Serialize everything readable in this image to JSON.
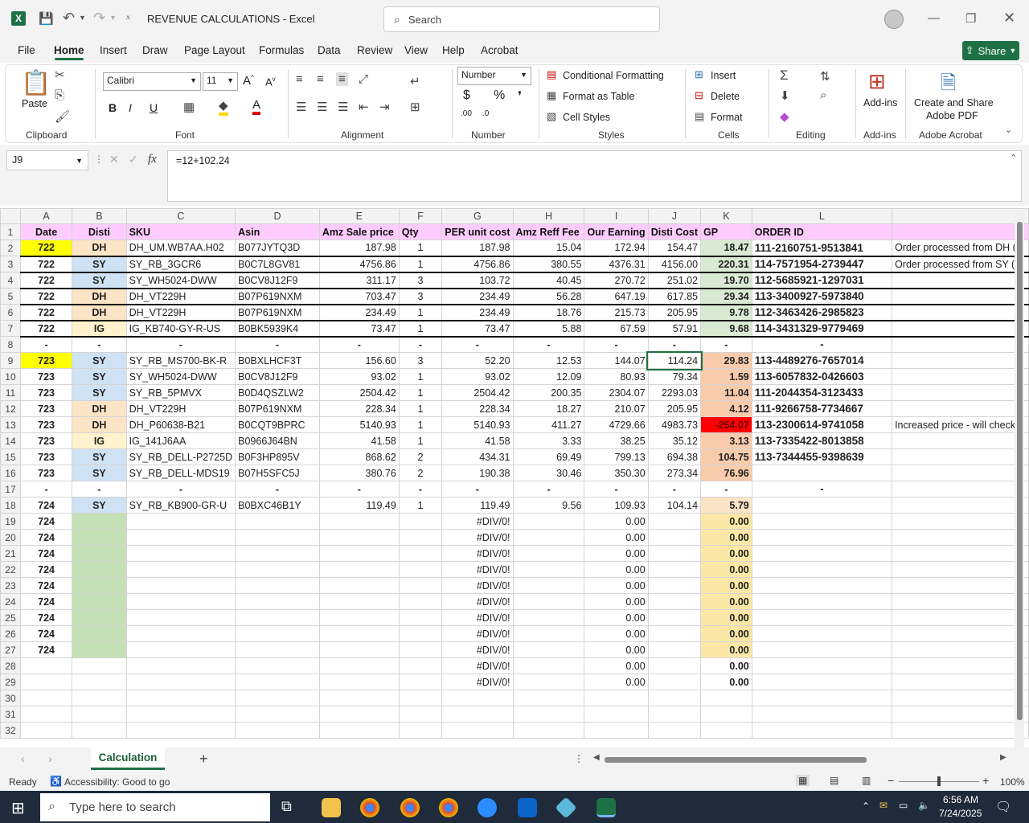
{
  "titlebar": {
    "title": "REVENUE CALCULATIONS  -  Excel",
    "search_placeholder": "Search"
  },
  "menu": {
    "items": [
      "File",
      "Home",
      "Insert",
      "Draw",
      "Page Layout",
      "Formulas",
      "Data",
      "Review",
      "View",
      "Help",
      "Acrobat"
    ],
    "active": "Home",
    "share_label": "Share"
  },
  "ribbon": {
    "clipboard": {
      "paste": "Paste",
      "label": "Clipboard"
    },
    "font": {
      "name": "Calibri",
      "size": "11",
      "label": "Font"
    },
    "alignment": {
      "label": "Alignment"
    },
    "number": {
      "format": "Number",
      "label": "Number"
    },
    "styles": {
      "conditional": "Conditional Formatting",
      "format_table": "Format as Table",
      "cell_styles": "Cell Styles",
      "label": "Styles"
    },
    "cells": {
      "insert": "Insert",
      "delete": "Delete",
      "format": "Format",
      "label": "Cells"
    },
    "editing": {
      "label": "Editing"
    },
    "addins": {
      "btn": "Add-ins",
      "label": "Add-ins"
    },
    "acrobat": {
      "btn1": "Create and Share",
      "btn2": "Adobe PDF",
      "label": "Adobe Acrobat"
    }
  },
  "formula": {
    "namebox": "J9",
    "fx": "fx",
    "value": "=12+102.24"
  },
  "columns": [
    "A",
    "B",
    "C",
    "D",
    "E",
    "F",
    "G",
    "H",
    "I",
    "J",
    "K",
    "L"
  ],
  "headers": [
    "Date",
    "Disti",
    "SKU",
    "Asin",
    "Amz Sale price",
    "Qty",
    "PER unit cost",
    "Amz Reff Fee",
    "Our Earning",
    "Disti Cost",
    "GP",
    "ORDER ID"
  ],
  "rows": [
    [
      "722",
      "DH",
      "DH_UM.WB7AA.H02",
      "B077JYTQ3D",
      "187.98",
      "1",
      "187.98",
      "15.04",
      "172.94",
      "154.47",
      "18.47",
      "111-2160751-9513841",
      "Order processed from DH ("
    ],
    [
      "722",
      "SY",
      "SY_RB_3GCR6",
      "B0C7L8GV81",
      "4756.86",
      "1",
      "4756.86",
      "380.55",
      "4376.31",
      "4156.00",
      "220.31",
      "114-7571954-2739447",
      "Order processed from SY (u"
    ],
    [
      "722",
      "SY",
      "SY_WH5024-DWW",
      "B0CV8J12F9",
      "311.17",
      "3",
      "103.72",
      "40.45",
      "270.72",
      "251.02",
      "19.70",
      "112-5685921-1297031",
      ""
    ],
    [
      "722",
      "DH",
      "DH_VT229H",
      "B07P619NXM",
      "703.47",
      "3",
      "234.49",
      "56.28",
      "647.19",
      "617.85",
      "29.34",
      "113-3400927-5973840",
      ""
    ],
    [
      "722",
      "DH",
      "DH_VT229H",
      "B07P619NXM",
      "234.49",
      "1",
      "234.49",
      "18.76",
      "215.73",
      "205.95",
      "9.78",
      "112-3463426-2985823",
      ""
    ],
    [
      "722",
      "IG",
      "IG_KB740-GY-R-US",
      "B0BK5939K4",
      "73.47",
      "1",
      "73.47",
      "5.88",
      "67.59",
      "57.91",
      "9.68",
      "114-3431329-9779469",
      ""
    ],
    [
      "-",
      "-",
      "-",
      "-",
      "-",
      "-",
      "-",
      "-",
      "-",
      "-",
      "-",
      "-",
      ""
    ],
    [
      "723",
      "SY",
      "SY_RB_MS700-BK-R",
      "B0BXLHCF3T",
      "156.60",
      "3",
      "52.20",
      "12.53",
      "144.07",
      "114.24",
      "29.83",
      "113-4489276-7657014",
      ""
    ],
    [
      "723",
      "SY",
      "SY_WH5024-DWW",
      "B0CV8J12F9",
      "93.02",
      "1",
      "93.02",
      "12.09",
      "80.93",
      "79.34",
      "1.59",
      "113-6057832-0426603",
      ""
    ],
    [
      "723",
      "SY",
      "SY_RB_5PMVX",
      "B0D4QSZLW2",
      "2504.42",
      "1",
      "2504.42",
      "200.35",
      "2304.07",
      "2293.03",
      "11.04",
      "111-2044354-3123433",
      ""
    ],
    [
      "723",
      "DH",
      "DH_VT229H",
      "B07P619NXM",
      "228.34",
      "1",
      "228.34",
      "18.27",
      "210.07",
      "205.95",
      "4.12",
      "111-9266758-7734667",
      ""
    ],
    [
      "723",
      "DH",
      "DH_P60638-B21",
      "B0CQT9BPRC",
      "5140.93",
      "1",
      "5140.93",
      "411.27",
      "4729.66",
      "4983.73",
      "-254.07",
      "113-2300614-9741058",
      "Increased price - will check"
    ],
    [
      "723",
      "IG",
      "IG_141J6AA",
      "B0966J64BN",
      "41.58",
      "1",
      "41.58",
      "3.33",
      "38.25",
      "35.12",
      "3.13",
      "113-7335422-8013858",
      ""
    ],
    [
      "723",
      "SY",
      "SY_RB_DELL-P2725D",
      "B0F3HP895V",
      "868.62",
      "2",
      "434.31",
      "69.49",
      "799.13",
      "694.38",
      "104.75",
      "113-7344455-9398639",
      ""
    ],
    [
      "723",
      "SY",
      "SY_RB_DELL-MDS19",
      "B07H5SFC5J",
      "380.76",
      "2",
      "190.38",
      "30.46",
      "350.30",
      "273.34",
      "76.96",
      "",
      ""
    ],
    [
      "-",
      "-",
      "-",
      "-",
      "-",
      "-",
      "-",
      "-",
      "-",
      "-",
      "-",
      "-",
      ""
    ],
    [
      "724",
      "SY",
      "SY_RB_KB900-GR-U",
      "B0BXC46B1Y",
      "119.49",
      "1",
      "119.49",
      "9.56",
      "109.93",
      "104.14",
      "5.79",
      "",
      ""
    ],
    [
      "724",
      "",
      "",
      "",
      "",
      "",
      "#DIV/0!",
      "",
      "0.00",
      "",
      "0.00",
      "",
      ""
    ],
    [
      "724",
      "",
      "",
      "",
      "",
      "",
      "#DIV/0!",
      "",
      "0.00",
      "",
      "0.00",
      "",
      ""
    ],
    [
      "724",
      "",
      "",
      "",
      "",
      "",
      "#DIV/0!",
      "",
      "0.00",
      "",
      "0.00",
      "",
      ""
    ],
    [
      "724",
      "",
      "",
      "",
      "",
      "",
      "#DIV/0!",
      "",
      "0.00",
      "",
      "0.00",
      "",
      ""
    ],
    [
      "724",
      "",
      "",
      "",
      "",
      "",
      "#DIV/0!",
      "",
      "0.00",
      "",
      "0.00",
      "",
      ""
    ],
    [
      "724",
      "",
      "",
      "",
      "",
      "",
      "#DIV/0!",
      "",
      "0.00",
      "",
      "0.00",
      "",
      ""
    ],
    [
      "724",
      "",
      "",
      "",
      "",
      "",
      "#DIV/0!",
      "",
      "0.00",
      "",
      "0.00",
      "",
      ""
    ],
    [
      "724",
      "",
      "",
      "",
      "",
      "",
      "#DIV/0!",
      "",
      "0.00",
      "",
      "0.00",
      "",
      ""
    ],
    [
      "724",
      "",
      "",
      "",
      "",
      "",
      "#DIV/0!",
      "",
      "0.00",
      "",
      "0.00",
      "",
      ""
    ],
    [
      "",
      "",
      "",
      "",
      "",
      "",
      "#DIV/0!",
      "",
      "0.00",
      "",
      "0.00",
      "",
      ""
    ],
    [
      "",
      "",
      "",
      "",
      "",
      "",
      "#DIV/0!",
      "",
      "0.00",
      "",
      "0.00",
      "",
      ""
    ],
    [
      "",
      "",
      "",
      "",
      "",
      "",
      "",
      "",
      "",
      "",
      "",
      "",
      ""
    ],
    [
      "",
      "",
      "",
      "",
      "",
      "",
      "",
      "",
      "",
      "",
      "",
      "",
      ""
    ],
    [
      "",
      "",
      "",
      "",
      "",
      "",
      "",
      "",
      "",
      "",
      "",
      "",
      ""
    ]
  ],
  "sheet": {
    "tab": "Calculation"
  },
  "status": {
    "ready": "Ready",
    "accessibility": "Accessibility: Good to go",
    "zoom": "100%"
  },
  "taskbar": {
    "search_placeholder": "Type here to search",
    "time": "6:56 AM",
    "date": "7/24/2025"
  },
  "colors": {
    "excel_green": "#1e7145",
    "header_pink": "#ffccff",
    "date_yellow": "#ffff00",
    "gp_negative": "#ff0000"
  }
}
